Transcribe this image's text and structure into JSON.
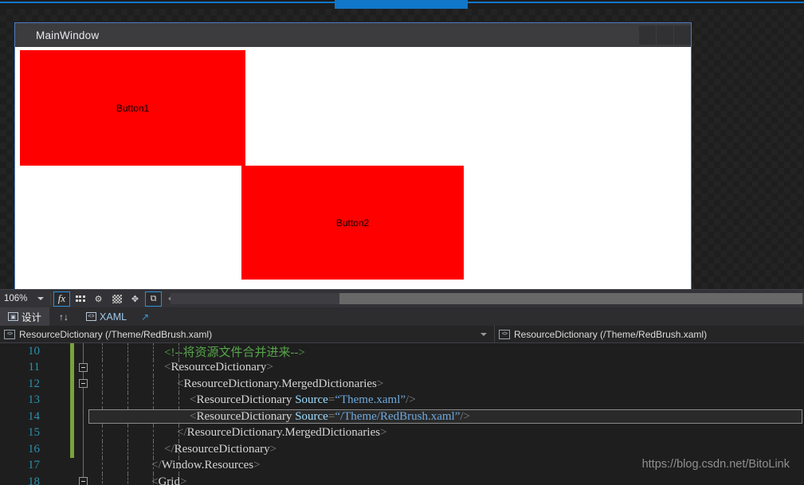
{
  "designer": {
    "window_title": "MainWindow",
    "window_buttons": [
      "minimize-button",
      "maximize-button",
      "close-button"
    ],
    "button1_label": "Button1",
    "button2_label": "Button2",
    "button_color": "#fe0000",
    "selection_border_color": "#4f7bc4"
  },
  "designer_toolbar": {
    "zoom_value": "106%",
    "icons": [
      {
        "name": "effects-fx-icon",
        "glyph": "fx",
        "selected": true
      },
      {
        "name": "snap-to-grid-icon",
        "glyph": "dots",
        "selected": false
      },
      {
        "name": "snap-to-gridlines-icon",
        "glyph": "⚙",
        "selected": false
      },
      {
        "name": "show-transparency-icon",
        "glyph": "checker",
        "selected": false
      },
      {
        "name": "snap-to-snaplines-icon",
        "glyph": "✥",
        "selected": false
      },
      {
        "name": "enable-project-code-icon",
        "glyph": "⧉",
        "selected": true
      }
    ],
    "collapse_pane_icon": "collapse-pane-icon"
  },
  "tabs": {
    "design_label": "设计",
    "swap_icon": "↑↓",
    "xaml_label": "XAML",
    "popout_icon": "↗"
  },
  "breadcrumbs": {
    "left": "ResourceDictionary (/Theme/RedBrush.xaml)",
    "right": "ResourceDictionary (/Theme/RedBrush.xaml)"
  },
  "editor": {
    "lines": [
      {
        "num": "10",
        "indent": 36,
        "html": "<span class='t-cmt'>&lt;!--将资源文件合并进来--&gt;</span>",
        "fold": false,
        "change": true,
        "highlight": false
      },
      {
        "num": "11",
        "indent": 36,
        "html": "<span class='t-punct'>&lt;</span><span class='t-tag'>ResourceDictionary</span><span class='t-punct'>&gt;</span>",
        "fold": true,
        "change": true,
        "highlight": false
      },
      {
        "num": "12",
        "indent": 52,
        "html": "<span class='t-punct'>&lt;</span><span class='t-tag'>ResourceDictionary.MergedDictionaries</span><span class='t-punct'>&gt;</span>",
        "fold": true,
        "change": true,
        "highlight": false
      },
      {
        "num": "13",
        "indent": 68,
        "html": "<span class='t-punct'>&lt;</span><span class='t-tag'>ResourceDictionary</span> <span class='t-attr'>Source</span><span class='t-punct'>=</span><span class='t-str'>“Theme.xaml”</span><span class='t-punct'>/&gt;</span>",
        "fold": false,
        "change": true,
        "highlight": false
      },
      {
        "num": "14",
        "indent": 68,
        "html": "<span class='t-punct'>&lt;</span><span class='t-tag'>ResourceDictionary</span> <span class='t-attr'>Source</span><span class='t-punct'>=</span><span class='t-str'>“/Theme/RedBrush.xaml”</span><span class='t-punct'>/&gt;</span>",
        "fold": false,
        "change": true,
        "highlight": true
      },
      {
        "num": "15",
        "indent": 52,
        "html": "<span class='t-punct'>&lt;/</span><span class='t-tag'>ResourceDictionary.MergedDictionaries</span><span class='t-punct'>&gt;</span>",
        "fold": false,
        "change": true,
        "highlight": false
      },
      {
        "num": "16",
        "indent": 36,
        "html": "<span class='t-punct'>&lt;/</span><span class='t-tag'>ResourceDictionary</span><span class='t-punct'>&gt;</span>",
        "fold": false,
        "change": true,
        "highlight": false
      },
      {
        "num": "17",
        "indent": 20,
        "html": "<span class='t-punct'>&lt;/</span><span class='t-tag'>Window.Resources</span><span class='t-punct'>&gt;</span>",
        "fold": false,
        "change": false,
        "highlight": false
      },
      {
        "num": "18",
        "indent": 20,
        "html": "<span class='t-punct'>&lt;</span><span class='t-tag'>Grid</span><span class='t-punct'>&gt;</span>",
        "fold": true,
        "change": false,
        "highlight": false
      }
    ]
  },
  "watermark": "https://blog.csdn.net/BitoLink"
}
